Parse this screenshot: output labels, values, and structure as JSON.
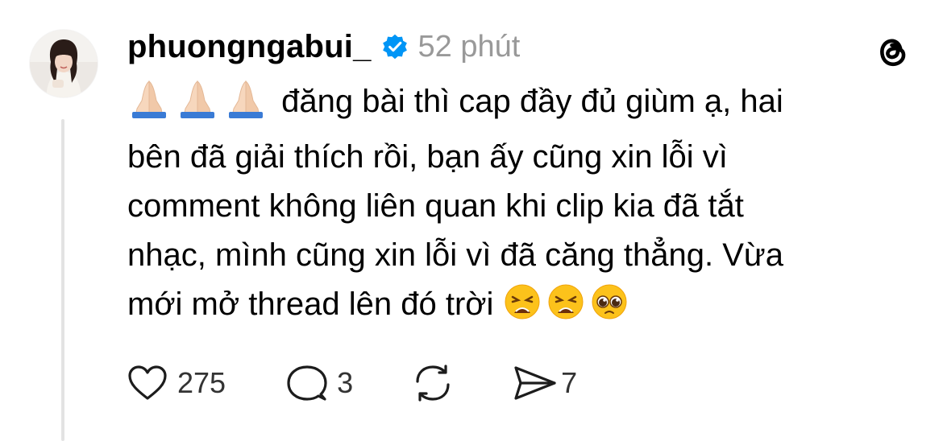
{
  "post": {
    "username": "phuongngabui_",
    "timestamp": "52 phút",
    "text_lines": [
      "đăng bài thì cap đầy đủ giùm ạ, hai",
      "bên đã giải thích rồi, bạn ấy cũng xin lỗi vì",
      "comment không liên quan khi clip kia đã tắt",
      "nhạc, mình cũng xin lỗi vì đã căng thẳng. Vừa",
      "mới mở thread lên đó trời"
    ],
    "leading_emoji": [
      "folded-hands",
      "folded-hands",
      "folded-hands"
    ],
    "trailing_emoji": [
      "weary-face",
      "weary-face",
      "pleading-face"
    ]
  },
  "actions": {
    "likes": "275",
    "replies": "3",
    "reposts": "",
    "shares": "7"
  },
  "icons": {
    "verified": "verified-badge-icon",
    "app": "threads-logo-icon",
    "like": "heart-icon",
    "reply": "comment-bubble-icon",
    "repost": "repost-icon",
    "share": "send-icon"
  },
  "colors": {
    "verified_blue": "#0095f6",
    "timestamp_gray": "#999999",
    "thread_line": "#e3e3e3"
  }
}
